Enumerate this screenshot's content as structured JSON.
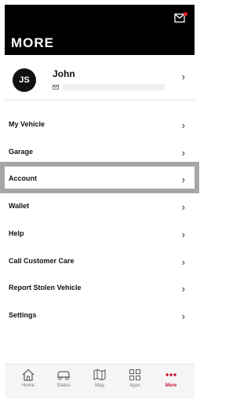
{
  "header": {
    "title": "MORE",
    "mail_icon": "mail-notification-icon",
    "badge_color": "#e02020"
  },
  "profile": {
    "initials": "JS",
    "name": "John"
  },
  "menu": [
    {
      "label": "My Vehicle"
    },
    {
      "label": "Garage"
    },
    {
      "label": "Account"
    },
    {
      "label": "Wallet"
    },
    {
      "label": "Help"
    },
    {
      "label": "Call Customer Care"
    },
    {
      "label": "Report Stolen Vehicle"
    },
    {
      "label": "Settings"
    }
  ],
  "chevron": "›",
  "tabs": [
    {
      "label": "Home",
      "icon": "home-icon"
    },
    {
      "label": "Status",
      "icon": "car-icon"
    },
    {
      "label": "Map",
      "icon": "map-icon"
    },
    {
      "label": "Apps",
      "icon": "apps-grid-icon"
    },
    {
      "label": "More",
      "icon": "more-dots-icon",
      "active": true
    }
  ],
  "accent_color": "#c8102e"
}
